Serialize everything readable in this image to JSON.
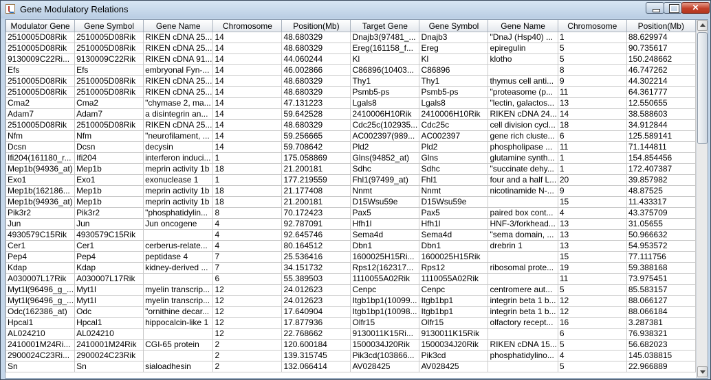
{
  "window": {
    "title": "Gene Modulatory Relations"
  },
  "table": {
    "columns": [
      "Modulator Gene",
      "Gene Symbol",
      "Gene Name",
      "Chromosome",
      "Position(Mb)",
      "Target Gene",
      "Gene Symbol",
      "Gene Name",
      "Chromosome",
      "Position(Mb)"
    ],
    "rows": [
      [
        "2510005D08Rik",
        "2510005D08Rik",
        "RIKEN cDNA 25...",
        "14",
        "48.680329",
        "Dnajb3(97481_...",
        "Dnajb3",
        "\"DnaJ (Hsp40) ...",
        "1",
        "88.629974"
      ],
      [
        "2510005D08Rik",
        "2510005D08Rik",
        "RIKEN cDNA 25...",
        "14",
        "48.680329",
        "Ereg(161158_f...",
        "Ereg",
        "epiregulin",
        "5",
        "90.735617"
      ],
      [
        "9130009C22Ri...",
        "9130009C22Rik",
        "RIKEN cDNA 91...",
        "14",
        "44.060244",
        "Kl",
        "Kl",
        "klotho",
        "5",
        "150.248662"
      ],
      [
        "Efs",
        "Efs",
        "embryonal Fyn-...",
        "14",
        "46.002866",
        "C86896(10403...",
        "C86896",
        "",
        "8",
        "46.747262"
      ],
      [
        "2510005D08Rik",
        "2510005D08Rik",
        "RIKEN cDNA 25...",
        "14",
        "48.680329",
        "Thy1",
        "Thy1",
        "thymus cell anti...",
        "9",
        "44.302214"
      ],
      [
        "2510005D08Rik",
        "2510005D08Rik",
        "RIKEN cDNA 25...",
        "14",
        "48.680329",
        "Psmb5-ps",
        "Psmb5-ps",
        "\"proteasome (p...",
        "11",
        "64.361777"
      ],
      [
        "Cma2",
        "Cma2",
        "\"chymase 2, ma...",
        "14",
        "47.131223",
        "Lgals8",
        "Lgals8",
        "\"lectin, galactos...",
        "13",
        "12.550655"
      ],
      [
        "Adam7",
        "Adam7",
        "a disintegrin an...",
        "14",
        "59.642528",
        "2410006H10Rik",
        "2410006H10Rik",
        "RIKEN cDNA 24...",
        "14",
        "38.588603"
      ],
      [
        "2510005D08Rik",
        "2510005D08Rik",
        "RIKEN cDNA 25...",
        "14",
        "48.680329",
        "Cdc25c(102935...",
        "Cdc25c",
        "cell division cycl...",
        "18",
        "34.912844"
      ],
      [
        "Nfm",
        "Nfm",
        "\"neurofilament, ...",
        "14",
        "59.256665",
        "AC002397(989...",
        "AC002397",
        "gene rich cluste...",
        "6",
        "125.589141"
      ],
      [
        "Dcsn",
        "Dcsn",
        "decysin",
        "14",
        "59.708642",
        "Pld2",
        "Pld2",
        "phospholipase ...",
        "11",
        "71.144811"
      ],
      [
        "Ifi204(161180_r...",
        "Ifi204",
        "interferon induci...",
        "1",
        "175.058869",
        "Glns(94852_at)",
        "Glns",
        "glutamine synth...",
        "1",
        "154.854456"
      ],
      [
        "Mep1b(94936_at)",
        "Mep1b",
        "meprin activity 1b",
        "18",
        "21.200181",
        "Sdhc",
        "Sdhc",
        "\"succinate dehy...",
        "1",
        "172.407387"
      ],
      [
        "Exo1",
        "Exo1",
        "exonuclease 1",
        "1",
        "177.219559",
        "Fhl1(97499_at)",
        "Fhl1",
        "four and a half L...",
        "20",
        "39.857982"
      ],
      [
        "Mep1b(162186...",
        "Mep1b",
        "meprin activity 1b",
        "18",
        "21.177408",
        "Nnmt",
        "Nnmt",
        "nicotinamide N-...",
        "9",
        "48.87525"
      ],
      [
        "Mep1b(94936_at)",
        "Mep1b",
        "meprin activity 1b",
        "18",
        "21.200181",
        "D15Wsu59e",
        "D15Wsu59e",
        "",
        "15",
        "11.433317"
      ],
      [
        "Pik3r2",
        "Pik3r2",
        "\"phosphatidylin...",
        "8",
        "70.172423",
        "Pax5",
        "Pax5",
        "paired box cont...",
        "4",
        "43.375709"
      ],
      [
        "Jun",
        "Jun",
        "Jun oncogene",
        "4",
        "92.787091",
        "Hfh1l",
        "Hfh1l",
        "HNF-3/forkhead...",
        "13",
        "31.05655"
      ],
      [
        "4930579C15Rik",
        "4930579C15Rik",
        "",
        "4",
        "92.645746",
        "Sema4d",
        "Sema4d",
        "\"sema domain, ...",
        "13",
        "50.966632"
      ],
      [
        "Cer1",
        "Cer1",
        "cerberus-relate...",
        "4",
        "80.164512",
        "Dbn1",
        "Dbn1",
        "drebrin 1",
        "13",
        "54.953572"
      ],
      [
        "Pep4",
        "Pep4",
        "peptidase 4",
        "7",
        "25.536416",
        "1600025H15Ri...",
        "1600025H15Rik",
        "",
        "15",
        "77.111756"
      ],
      [
        "Kdap",
        "Kdap",
        "kidney-derived ...",
        "7",
        "34.151732",
        "Rps12(162317...",
        "Rps12",
        "ribosomal prote...",
        "19",
        "59.388168"
      ],
      [
        "A030007L17Rik",
        "A030007L17Rik",
        "",
        "6",
        "55.389503",
        "1110055A02Rik",
        "1110055A02Rik",
        "",
        "11",
        "73.975451"
      ],
      [
        "Myt1l(96496_g_...",
        "Myt1l",
        "myelin transcrip...",
        "12",
        "24.012623",
        "Cenpc",
        "Cenpc",
        "centromere aut...",
        "5",
        "85.583157"
      ],
      [
        "Myt1l(96496_g_...",
        "Myt1l",
        "myelin transcrip...",
        "12",
        "24.012623",
        "Itgb1bp1(10099...",
        "Itgb1bp1",
        "integrin beta 1 b...",
        "12",
        "88.066127"
      ],
      [
        "Odc(162386_at)",
        "Odc",
        "\"ornithine decar...",
        "12",
        "17.640904",
        "Itgb1bp1(10098...",
        "Itgb1bp1",
        "integrin beta 1 b...",
        "12",
        "88.066184"
      ],
      [
        "Hpcal1",
        "Hpcal1",
        "hippocalcin-like 1",
        "12",
        "17.877936",
        "Olfr15",
        "Olfr15",
        "olfactory recept...",
        "16",
        "3.287381"
      ],
      [
        "AL024210",
        "AL024210",
        "",
        "12",
        "22.768662",
        "9130011K15Ri...",
        "9130011K15Rik",
        "",
        "6",
        "76.938321"
      ],
      [
        "2410001M24Ri...",
        "2410001M24Rik",
        "CGI-65 protein",
        "2",
        "120.600184",
        "1500034J20Rik",
        "1500034J20Rik",
        "RIKEN cDNA 15...",
        "5",
        "56.682023"
      ],
      [
        "2900024C23Ri...",
        "2900024C23Rik",
        "",
        "2",
        "139.315745",
        "Pik3cd(103866...",
        "Pik3cd",
        "phosphatidylino...",
        "4",
        "145.038815"
      ],
      [
        "Sn",
        "Sn",
        "sialoadhesin",
        "2",
        "132.066414",
        "AV028425",
        "AV028425",
        "",
        "5",
        "22.966889"
      ]
    ]
  }
}
